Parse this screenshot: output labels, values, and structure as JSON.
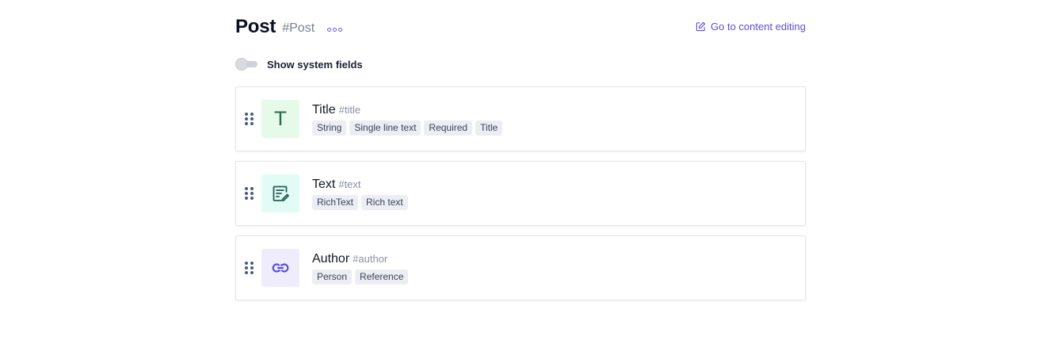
{
  "header": {
    "title": "Post",
    "api_id": "#Post",
    "go_link": "Go to content editing"
  },
  "system_fields": {
    "label": "Show system fields",
    "enabled": false
  },
  "fields": [
    {
      "name": "Title",
      "api_id": "#title",
      "icon": "text-t-icon",
      "tags": [
        "String",
        "Single line text",
        "Required",
        "Title"
      ]
    },
    {
      "name": "Text",
      "api_id": "#text",
      "icon": "rich-text-icon",
      "tags": [
        "RichText",
        "Rich text"
      ]
    },
    {
      "name": "Author",
      "api_id": "#author",
      "icon": "link-icon",
      "tags": [
        "Person",
        "Reference"
      ]
    }
  ],
  "icon_glyphs": {
    "title_letter": "T"
  },
  "colors": {
    "accent": "#5b4fd6",
    "title_icon_bg": "#e6faea",
    "text_icon_bg": "#e2fbf5",
    "author_icon_bg": "#efedfc"
  }
}
